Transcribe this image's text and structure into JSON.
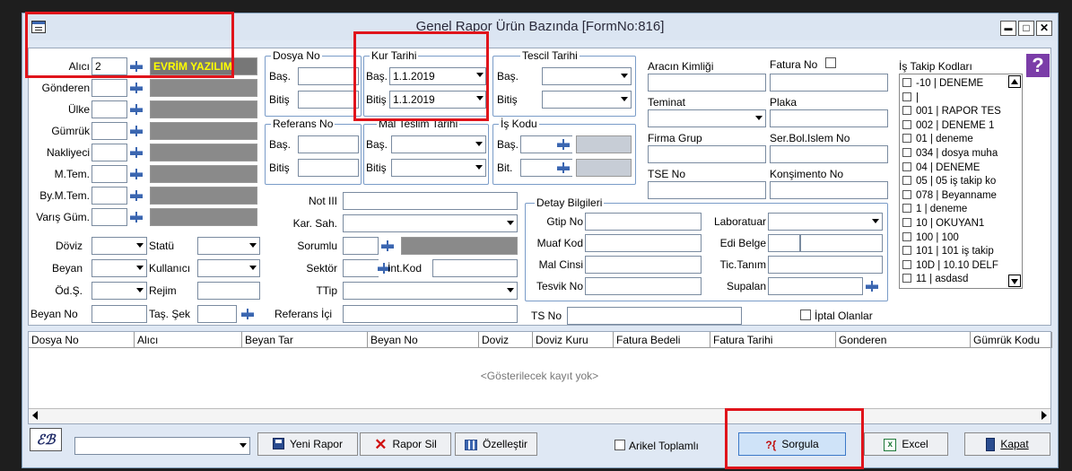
{
  "window": {
    "title": "Genel Rapor Ürün Bazında [FormNo:816]",
    "controls": {
      "minimize": "▬",
      "maximize": "□",
      "close": "✕"
    }
  },
  "left": {
    "alici_label": "Alıcı",
    "alici_value": "2",
    "alici_name": "EVRİM YAZILIM",
    "gonderen_label": "Gönderen",
    "ulke_label": "Ülke",
    "gumruk_label": "Gümrük",
    "nakliyeci_label": "Nakliyeci",
    "mtem_label": "M.Tem.",
    "bymtem_label": "By.M.Tem.",
    "varis_label": "Varış Güm.",
    "doviz_label": "Döviz",
    "beyan_label": "Beyan",
    "ods_label": "Öd.Ş.",
    "beyanno_label": "Beyan No",
    "statu_label": "Statü",
    "kullanici_label": "Kullanıcı",
    "rejim_label": "Rejim",
    "tassek_label": "Taş. Şek"
  },
  "groups": {
    "dosya_no": "Dosya No",
    "kur_tarihi": "Kur Tarihi",
    "tescil_tarihi": "Tescil Tarihi",
    "referans_no": "Referans No",
    "mal_teslim_tarihi": "Mal Teslim Tarihi",
    "is_kodu": "İş Kodu",
    "detay_bilgileri": "Detay Bilgileri",
    "bas": "Baş.",
    "bitis": "Bitiş",
    "bit": "Bit.",
    "kur_bas_value": "1.1.2019",
    "kur_bitis_value": "1.1.2019"
  },
  "middle": {
    "not3": "Not III",
    "kar_sah": "Kar. Sah.",
    "sorumlu": "Sorumlu",
    "sektor": "Sektör",
    "intkod": "İnt.Kod",
    "ttip": "TTip",
    "referans_ici": "Referans İçi"
  },
  "right": {
    "aracin_kimligi": "Aracın Kimliği",
    "fatura_no": "Fatura No",
    "teminat": "Teminat",
    "plaka": "Plaka",
    "firma_grup": "Firma Grup",
    "ser_bol": "Ser.Bol.Islem No",
    "tse_no": "TSE No",
    "konsimento": "Konşimento No",
    "is_takip": "İş Takip Kodları",
    "help": "?"
  },
  "detay": {
    "gtip_no": "Gtip No",
    "laboratuar": "Laboratuar",
    "muaf_kod": "Muaf Kod",
    "edi_belge": "Edi Belge",
    "mal_cinsi": "Mal Cinsi",
    "tic_tanim": "Tic.Tanım",
    "tesvik_no": "Tesvik No",
    "supalan": "Supalan"
  },
  "ts_no": "TS No",
  "iptal": "İptal Olanlar",
  "is_takip_items": [
    "-10 | DENEME",
    "|",
    "001 | RAPOR TES",
    "002 | DENEME 1",
    "01 | deneme",
    "034 | dosya muha",
    "04 | DENEME",
    "05 | 05 iş takip ko",
    "078 | Beyanname",
    "1 | deneme",
    "10 | OKUYAN1",
    "100 | 100",
    "101 | 101 iş takip",
    "10D | 10.10 DELF",
    "11 | asdasd"
  ],
  "grid": {
    "columns": [
      "Dosya No",
      "Alıcı",
      "Beyan Tar",
      "Beyan No",
      "Doviz",
      "Doviz Kuru",
      "Fatura Bedeli",
      "Fatura Tarihi",
      "Gonderen",
      "Gümrük Kodu"
    ],
    "empty_text": "<Gösterilecek kayıt yok>"
  },
  "bottom": {
    "logo": "ℰℬ",
    "yeni_rapor": "Yeni Rapor",
    "rapor_sil": "Rapor Sil",
    "ozellestir": "Özelleştir",
    "arikel": "Arikel Toplamlı",
    "sorgula": "Sorgula",
    "excel": "Excel",
    "kapat": "Kapat"
  },
  "colors": {
    "accent": "#3b66b0",
    "highlight": "#e0141b",
    "brand_text": "#ffff00"
  }
}
